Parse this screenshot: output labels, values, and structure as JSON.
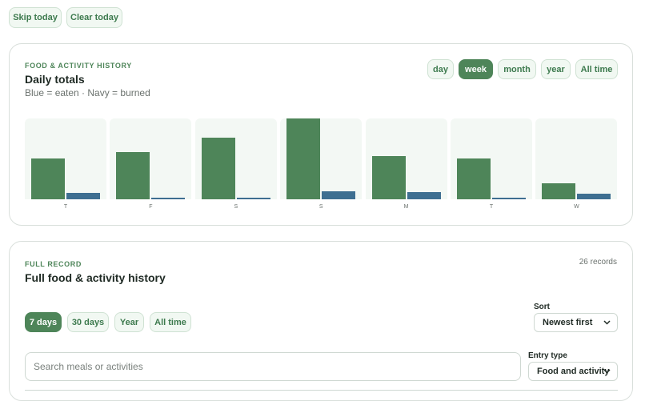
{
  "top_actions": {
    "skip": "Skip today",
    "clear": "Clear today"
  },
  "history_card": {
    "eyebrow": "FOOD & ACTIVITY HISTORY",
    "title": "Daily totals",
    "subtitle": "Blue = eaten · Navy = burned",
    "ranges": [
      "day",
      "week",
      "month",
      "year",
      "All time"
    ],
    "active_range": "week"
  },
  "chart_data": {
    "type": "bar",
    "categories": [
      "T",
      "F",
      "S",
      "S",
      "M",
      "T",
      "W"
    ],
    "series": [
      {
        "name": "eaten",
        "values": [
          0.5,
          0.58,
          0.76,
          1.0,
          0.53,
          0.5,
          0.2
        ]
      },
      {
        "name": "burned",
        "values": [
          0.08,
          0.02,
          0.02,
          0.1,
          0.09,
          0.02,
          0.07
        ]
      }
    ],
    "colors": {
      "eaten": "#4e8559",
      "burned": "#3e6f91"
    }
  },
  "record_card": {
    "eyebrow": "FULL RECORD",
    "title": "Full food & activity history",
    "count": "26 records",
    "periods": [
      "7 days",
      "30 days",
      "Year",
      "All time"
    ],
    "active_period": "7 days",
    "sort": {
      "label": "Sort",
      "value": "Newest first"
    },
    "search": {
      "placeholder": "Search meals or activities",
      "value": ""
    },
    "entry_type": {
      "label": "Entry type",
      "value": "Food and activity"
    }
  }
}
